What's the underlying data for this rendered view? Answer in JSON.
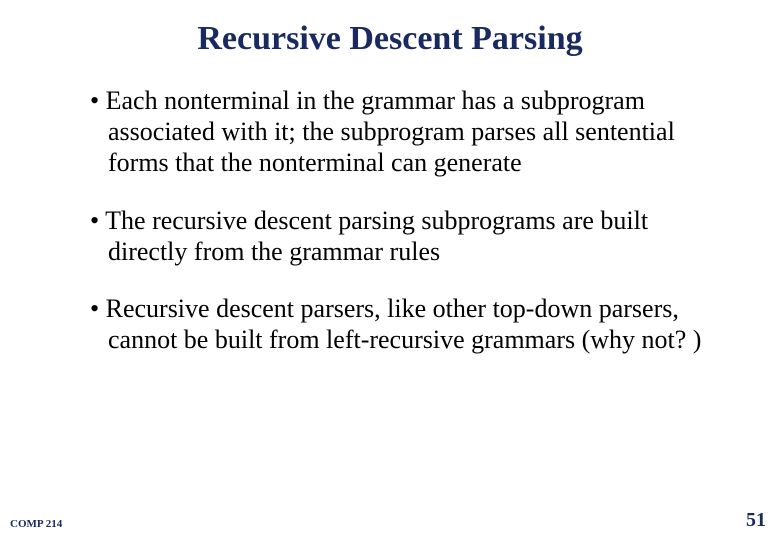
{
  "title": "Recursive Descent Parsing",
  "bullets": [
    "Each nonterminal in the grammar has a subprogram associated with it; the subprogram parses all sentential forms that the nonterminal can generate",
    "The recursive descent parsing subprograms are built directly from the grammar rules",
    "Recursive descent parsers, like other top-down parsers, cannot be built from left-recursive grammars (why not? )"
  ],
  "footer": {
    "course": "COMP 214",
    "page": "51"
  }
}
